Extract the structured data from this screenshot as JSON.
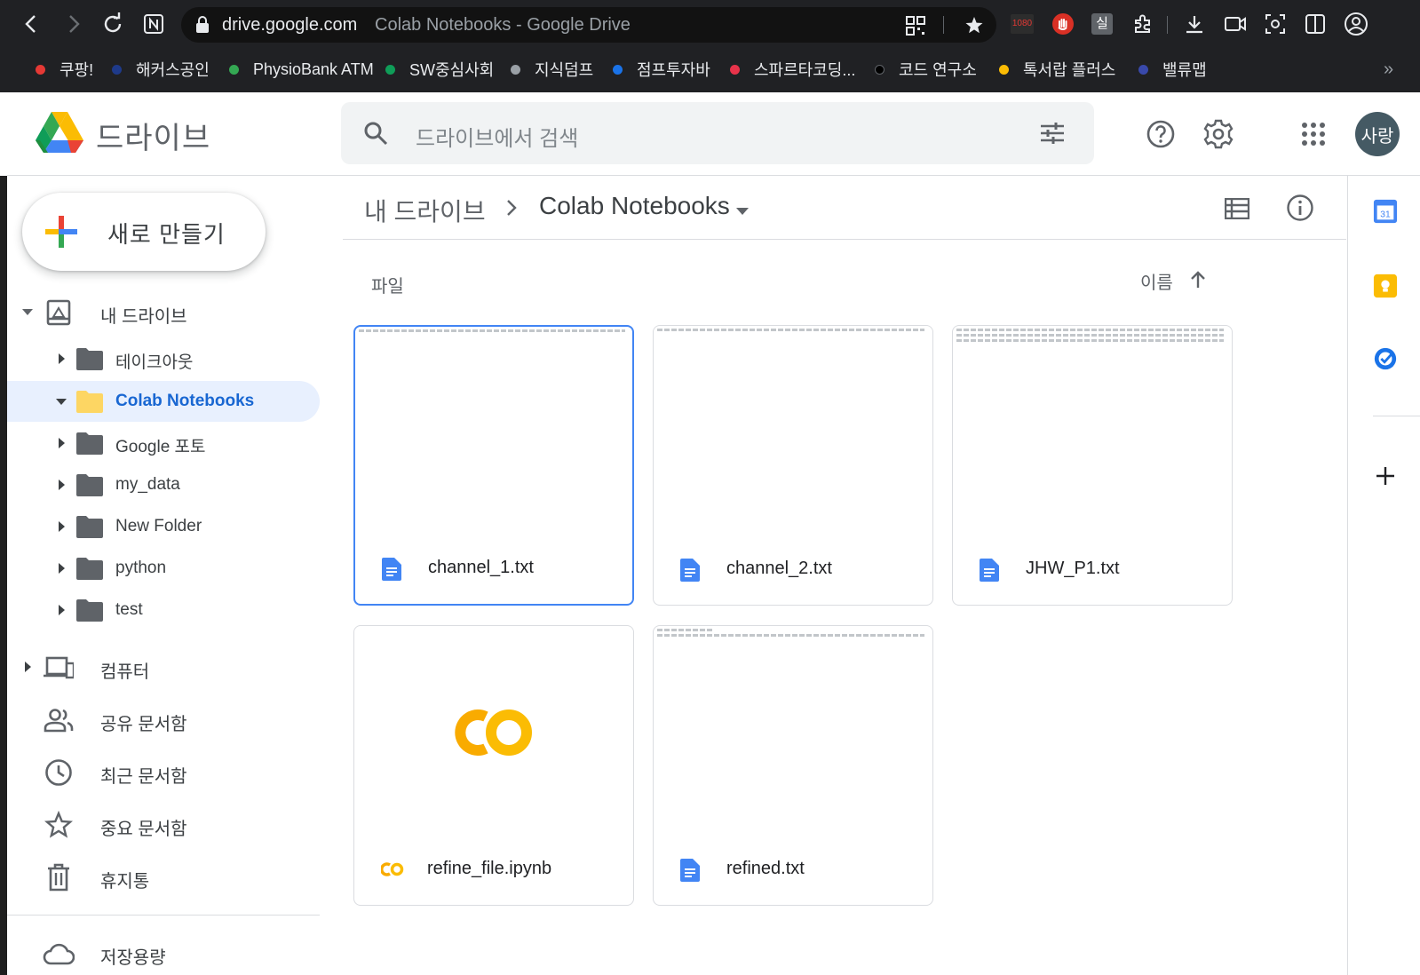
{
  "browser": {
    "url_domain": "drive.google.com",
    "page_title": "Colab Notebooks - Google Drive",
    "extension_badge": "1080",
    "extension_label_kr": "실",
    "bookmarks": [
      {
        "label": "쿠팡!",
        "color": "#e53935"
      },
      {
        "label": "해커스공인",
        "color": "#1e3a8a"
      },
      {
        "label": "PhysioBank ATM",
        "color": "#34a853"
      },
      {
        "label": "SW중심사회",
        "color": "#0f9d58"
      },
      {
        "label": "지식덤프",
        "color": "#9aa0a6"
      },
      {
        "label": "점프투자바",
        "color": "#1a73e8"
      },
      {
        "label": "스파르타코딩...",
        "color": "#e8334a"
      },
      {
        "label": "코드 연구소",
        "color": "#000000"
      },
      {
        "label": "톡서랍 플러스",
        "color": "#fbbc04"
      },
      {
        "label": "밸류맵",
        "color": "#3949ab"
      }
    ],
    "bookmarks_overflow": "»"
  },
  "header": {
    "product_name": "드라이브",
    "search_placeholder": "드라이브에서 검색",
    "avatar_text": "사랑"
  },
  "sidebar": {
    "new_button_label": "새로 만들기",
    "my_drive_label": "내 드라이브",
    "folders": [
      {
        "label": "테이크아웃",
        "active": false
      },
      {
        "label": "Colab Notebooks",
        "active": true
      },
      {
        "label": "Google 포토",
        "active": false
      },
      {
        "label": "my_data",
        "active": false
      },
      {
        "label": "New Folder",
        "active": false
      },
      {
        "label": "python",
        "active": false
      },
      {
        "label": "test",
        "active": false
      }
    ],
    "computers_label": "컴퓨터",
    "shared_label": "공유 문서함",
    "recent_label": "최근 문서함",
    "starred_label": "중요 문서함",
    "trash_label": "휴지통",
    "storage_label": "저장용량"
  },
  "main": {
    "breadcrumb_root": "내 드라이브",
    "breadcrumb_current": "Colab Notebooks",
    "section_title": "파일",
    "sort_label": "이름",
    "files": [
      {
        "name": "channel_1.txt",
        "type": "doc",
        "selected": true
      },
      {
        "name": "channel_2.txt",
        "type": "doc",
        "selected": false
      },
      {
        "name": "JHW_P1.txt",
        "type": "doc",
        "selected": false
      },
      {
        "name": "refine_file.ipynb",
        "type": "colab",
        "selected": false
      },
      {
        "name": "refined.txt",
        "type": "doc",
        "selected": false
      }
    ]
  },
  "right_panel": {
    "calendar_day": "31"
  },
  "colors": {
    "accent_blue": "#1a73e8",
    "active_bg": "#e8f0fe",
    "colab_orange": "#f9ab00",
    "colab_yellow": "#fbbc04"
  }
}
